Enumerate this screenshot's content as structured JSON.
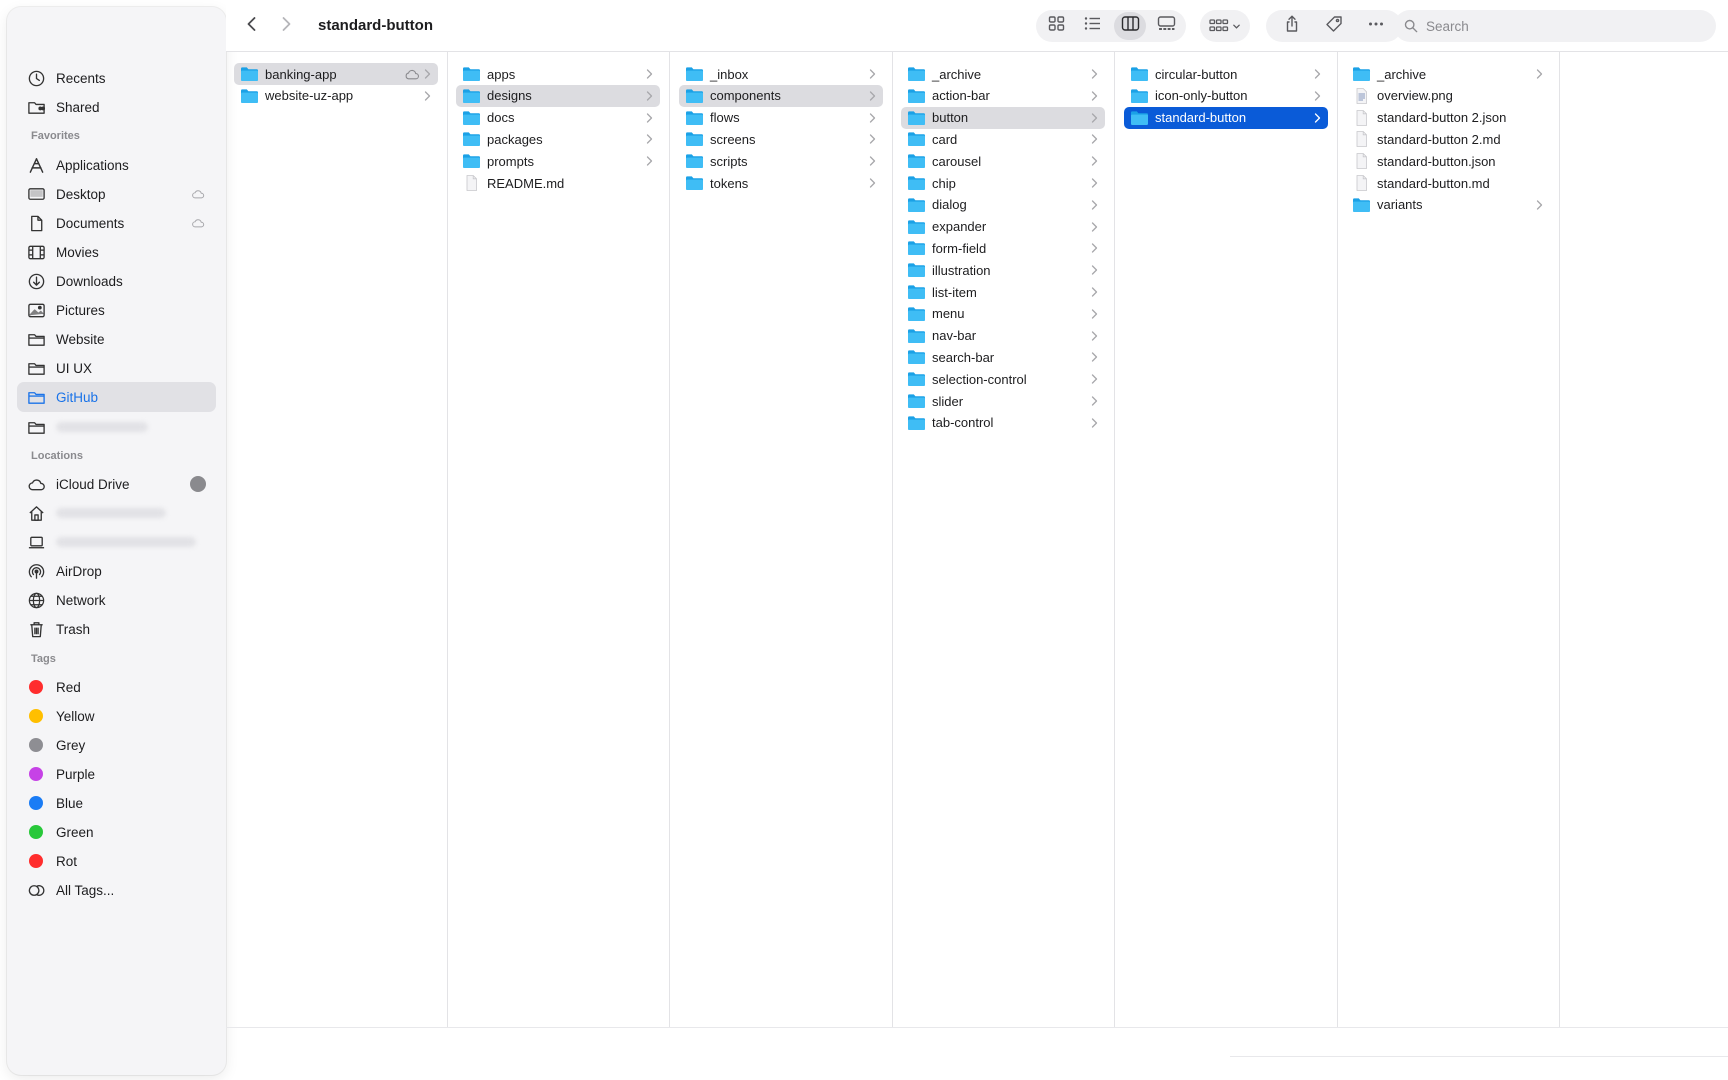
{
  "window": {
    "title": "standard-button",
    "search_placeholder": "Search"
  },
  "toolbar": {
    "buttons": [
      "back-icon",
      "forward-icon",
      "icon-view-icon",
      "list-view-icon",
      "column-view-icon",
      "gallery-view-icon",
      "group-icon",
      "share-icon",
      "tag-icon",
      "more-icon"
    ],
    "active_view": "column"
  },
  "sidebar": {
    "top": [
      {
        "label": "Recents",
        "icon": "clock-icon"
      },
      {
        "label": "Shared",
        "icon": "shared-folder-icon"
      }
    ],
    "favorites_title": "Favorites",
    "favorites": [
      {
        "label": "Applications",
        "icon": "applications-icon"
      },
      {
        "label": "Desktop",
        "icon": "desktop-icon"
      },
      {
        "label": "Documents",
        "icon": "document-icon"
      },
      {
        "label": "Movies",
        "icon": "film-icon"
      },
      {
        "label": "Downloads",
        "icon": "download-icon"
      },
      {
        "label": "Pictures",
        "icon": "photo-icon"
      },
      {
        "label": "Website",
        "icon": "folder-icon"
      },
      {
        "label": "UI UX",
        "icon": "folder-icon"
      },
      {
        "label": "GitHub",
        "icon": "folder-icon"
      }
    ],
    "locations_title": "Locations",
    "locations": [
      {
        "label": "iCloud Drive",
        "icon": "cloud-icon"
      },
      {
        "label": "AirDrop",
        "icon": "airdrop-icon"
      },
      {
        "label": "Network",
        "icon": "globe-icon"
      },
      {
        "label": "Trash",
        "icon": "trash-icon"
      }
    ],
    "tags_title": "Tags",
    "tags": [
      {
        "label": "Red",
        "color": "#ff2d2d"
      },
      {
        "label": "Yellow",
        "color": "#ffbf00"
      },
      {
        "label": "Grey",
        "color": "#8e8e93"
      },
      {
        "label": "Purple",
        "color": "#c642e6"
      },
      {
        "label": "Blue",
        "color": "#1a7cf5"
      },
      {
        "label": "Green",
        "color": "#28c83a"
      },
      {
        "label": "Rot",
        "color": "#ff2d2d"
      }
    ],
    "all_tags": "All Tags...",
    "selected": "GitHub",
    "accent_color": "#1a73e8"
  },
  "columns": [
    [
      {
        "name": "banking-app",
        "type": "folder",
        "state": "path",
        "cloud": true
      },
      {
        "name": "website-uz-app",
        "type": "folder"
      }
    ],
    [
      {
        "name": "apps",
        "type": "folder"
      },
      {
        "name": "designs",
        "type": "folder",
        "state": "path"
      },
      {
        "name": "docs",
        "type": "folder"
      },
      {
        "name": "packages",
        "type": "folder"
      },
      {
        "name": "prompts",
        "type": "folder"
      },
      {
        "name": "README.md",
        "type": "file"
      }
    ],
    [
      {
        "name": "_inbox",
        "type": "folder"
      },
      {
        "name": "components",
        "type": "folder",
        "state": "path"
      },
      {
        "name": "flows",
        "type": "folder"
      },
      {
        "name": "screens",
        "type": "folder"
      },
      {
        "name": "scripts",
        "type": "folder"
      },
      {
        "name": "tokens",
        "type": "folder"
      }
    ],
    [
      {
        "name": "_archive",
        "type": "folder"
      },
      {
        "name": "action-bar",
        "type": "folder"
      },
      {
        "name": "button",
        "type": "folder",
        "state": "path"
      },
      {
        "name": "card",
        "type": "folder"
      },
      {
        "name": "carousel",
        "type": "folder"
      },
      {
        "name": "chip",
        "type": "folder"
      },
      {
        "name": "dialog",
        "type": "folder"
      },
      {
        "name": "expander",
        "type": "folder"
      },
      {
        "name": "form-field",
        "type": "folder"
      },
      {
        "name": "illustration",
        "type": "folder"
      },
      {
        "name": "list-item",
        "type": "folder"
      },
      {
        "name": "menu",
        "type": "folder"
      },
      {
        "name": "nav-bar",
        "type": "folder"
      },
      {
        "name": "search-bar",
        "type": "folder"
      },
      {
        "name": "selection-control",
        "type": "folder"
      },
      {
        "name": "slider",
        "type": "folder"
      },
      {
        "name": "tab-control",
        "type": "folder"
      }
    ],
    [
      {
        "name": "circular-button",
        "type": "folder"
      },
      {
        "name": "icon-only-button",
        "type": "folder"
      },
      {
        "name": "standard-button",
        "type": "folder",
        "state": "selected"
      }
    ],
    [
      {
        "name": "_archive",
        "type": "folder"
      },
      {
        "name": "overview.png",
        "type": "image"
      },
      {
        "name": "standard-button 2.json",
        "type": "file"
      },
      {
        "name": "standard-button 2.md",
        "type": "file"
      },
      {
        "name": "standard-button.json",
        "type": "file"
      },
      {
        "name": "standard-button.md",
        "type": "file"
      },
      {
        "name": "variants",
        "type": "folder"
      }
    ]
  ]
}
